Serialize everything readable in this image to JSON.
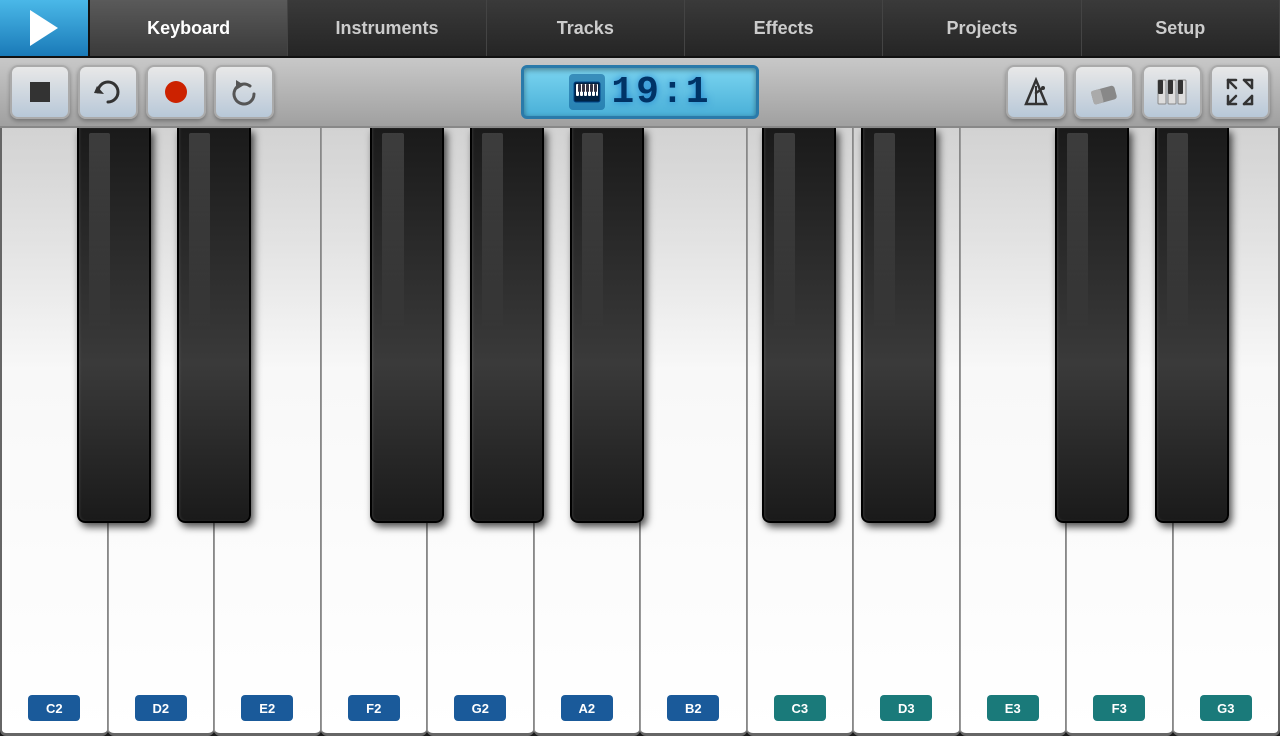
{
  "nav": {
    "play_label": "▶",
    "tabs": [
      {
        "id": "keyboard",
        "label": "Keyboard",
        "active": true
      },
      {
        "id": "instruments",
        "label": "Instruments",
        "active": false
      },
      {
        "id": "tracks",
        "label": "Tracks",
        "active": false
      },
      {
        "id": "effects",
        "label": "Effects",
        "active": false
      },
      {
        "id": "projects",
        "label": "Projects",
        "active": false
      },
      {
        "id": "setup",
        "label": "Setup",
        "active": false
      }
    ]
  },
  "toolbar": {
    "stop_label": "■",
    "loop_label": "↻",
    "record_label": "●",
    "undo_label": "↩",
    "display_time": "19:1",
    "metronome_label": "⏱",
    "eraser_label": "◇",
    "piano_label": "🎹",
    "expand_label": "⤢"
  },
  "keyboard": {
    "white_keys": [
      {
        "note": "C2",
        "label_class": "label-blue"
      },
      {
        "note": "D2",
        "label_class": "label-blue"
      },
      {
        "note": "E2",
        "label_class": "label-blue"
      },
      {
        "note": "F2",
        "label_class": "label-blue"
      },
      {
        "note": "G2",
        "label_class": "label-blue"
      },
      {
        "note": "A2",
        "label_class": "label-blue"
      },
      {
        "note": "B2",
        "label_class": "label-blue"
      },
      {
        "note": "C3",
        "label_class": "label-teal"
      },
      {
        "note": "D3",
        "label_class": "label-teal"
      },
      {
        "note": "E3",
        "label_class": "label-teal"
      },
      {
        "note": "F3",
        "label_class": "label-teal"
      },
      {
        "note": "G3",
        "label_class": "label-teal"
      }
    ],
    "black_key_positions": [
      {
        "note": "C#2",
        "left_pct": 6.0
      },
      {
        "note": "D#2",
        "left_pct": 13.8
      },
      {
        "note": "F#2",
        "left_pct": 28.9
      },
      {
        "note": "G#2",
        "left_pct": 36.7
      },
      {
        "note": "A#2",
        "left_pct": 44.5
      },
      {
        "note": "C#3",
        "left_pct": 59.5
      },
      {
        "note": "D#3",
        "left_pct": 67.3
      },
      {
        "note": "F#3",
        "left_pct": 82.4
      },
      {
        "note": "G#3",
        "left_pct": 90.2
      }
    ]
  }
}
